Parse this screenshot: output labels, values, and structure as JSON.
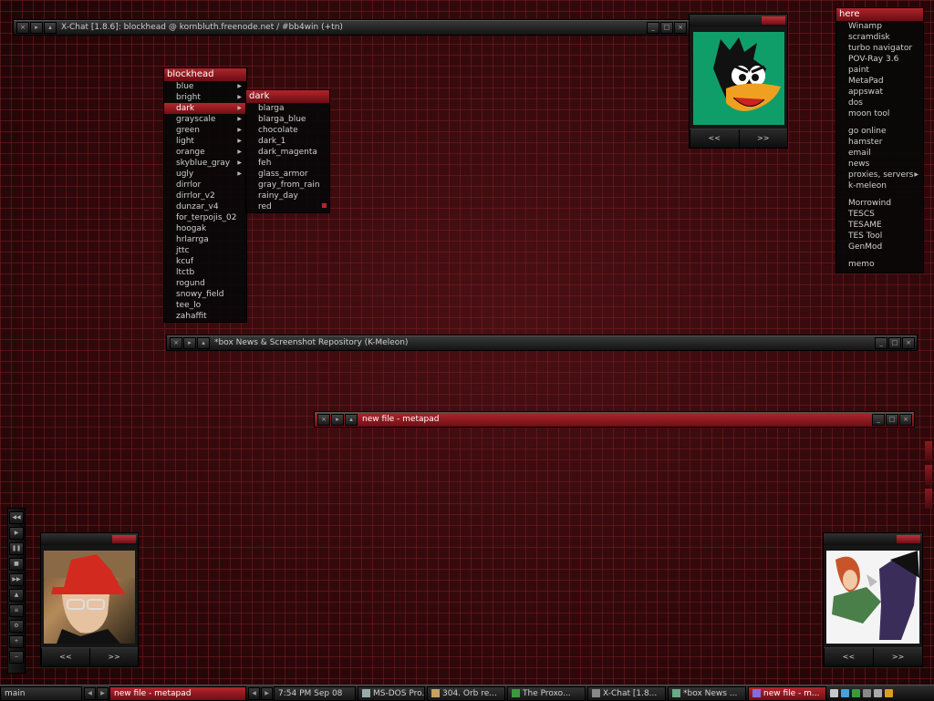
{
  "xchat_window": {
    "title": "X-Chat [1.8.6]: blockhead @ kornbluth.freenode.net / #bb4win (+tn)"
  },
  "kmeleon_window": {
    "title": "*box News & Screenshot Repository (K-Meleon)"
  },
  "metapad_window": {
    "title": "new file - metapad"
  },
  "blockhead_menu": {
    "header": "blockhead",
    "items": [
      {
        "label": "blue",
        "submenu": true
      },
      {
        "label": "bright",
        "submenu": true
      },
      {
        "label": "dark",
        "submenu": true,
        "active": true
      },
      {
        "label": "grayscale",
        "submenu": true
      },
      {
        "label": "green",
        "submenu": true
      },
      {
        "label": "light",
        "submenu": true
      },
      {
        "label": "orange",
        "submenu": true
      },
      {
        "label": "skyblue_gray",
        "submenu": true
      },
      {
        "label": "ugly",
        "submenu": true
      },
      {
        "label": "dirrlor"
      },
      {
        "label": "dirrlor_v2"
      },
      {
        "label": "dunzar_v4"
      },
      {
        "label": "for_terpojis_02"
      },
      {
        "label": "hoogak"
      },
      {
        "label": "hrlarrga"
      },
      {
        "label": "jttc"
      },
      {
        "label": "kcuf"
      },
      {
        "label": "ltctb"
      },
      {
        "label": "rogund"
      },
      {
        "label": "snowy_field"
      },
      {
        "label": "tee_lo"
      },
      {
        "label": "zahaffit"
      }
    ]
  },
  "dark_menu": {
    "header": "dark",
    "items": [
      "blarga",
      "blarga_blue",
      "chocolate",
      "dark_1",
      "dark_magenta",
      "feh",
      "glass_armor",
      "gray_from_rain",
      "rainy_day",
      "red"
    ]
  },
  "here_menu": {
    "header": "here",
    "groups": [
      [
        {
          "label": "Winamp"
        },
        {
          "label": "scramdisk"
        },
        {
          "label": "turbo navigator"
        },
        {
          "label": "POV-Ray 3.6"
        },
        {
          "label": "paint"
        },
        {
          "label": "MetaPad"
        },
        {
          "label": "appswat"
        },
        {
          "label": "dos"
        },
        {
          "label": "moon tool"
        }
      ],
      [
        {
          "label": "go online"
        },
        {
          "label": "hamster"
        },
        {
          "label": "email"
        },
        {
          "label": "news"
        },
        {
          "label": "proxies, servers",
          "submenu": true
        },
        {
          "label": "k-meleon"
        }
      ],
      [
        {
          "label": "Morrowind"
        },
        {
          "label": "TESCS"
        },
        {
          "label": "TESAME"
        },
        {
          "label": "TES Tool"
        },
        {
          "label": "GenMod"
        }
      ],
      [
        {
          "label": "memo"
        }
      ]
    ]
  },
  "image_widgets": {
    "prev_label": "<<",
    "next_label": ">>"
  },
  "taskbar": {
    "workspace": "main",
    "current_task": "new file - metapad",
    "clock": "7:54 PM Sep 08",
    "tasks": [
      {
        "label": "MS-DOS Pro...",
        "icon": "dos-icon"
      },
      {
        "label": "304. Orb re...",
        "icon": "orb-icon"
      },
      {
        "label": "The Proxo...",
        "icon": "proxo-icon"
      },
      {
        "label": "X-Chat [1.8...",
        "icon": "xchat-icon"
      },
      {
        "label": "*box News ...",
        "icon": "kmeleon-icon"
      },
      {
        "label": "new file - m...",
        "icon": "metapad-icon",
        "active": true
      }
    ]
  },
  "colors": {
    "accent": "#b3262e",
    "background": "#3a0a0c"
  }
}
